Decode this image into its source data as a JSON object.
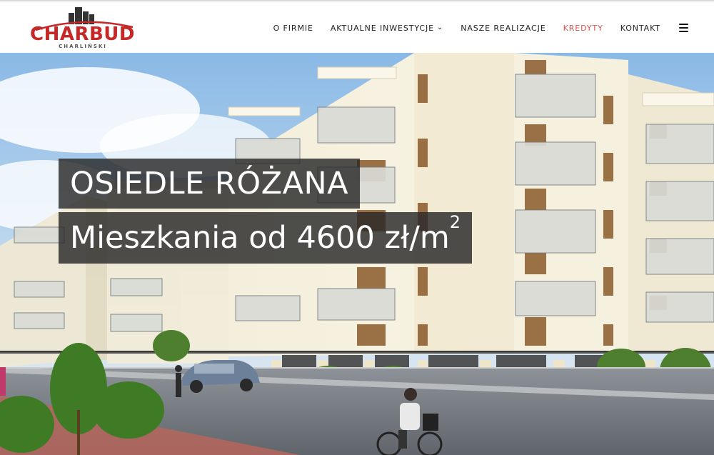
{
  "brand": {
    "name": "CHARBUD",
    "subtitle": "CHARLIŃSKI",
    "red": "#c62828",
    "dark": "#333333"
  },
  "nav": {
    "items": [
      {
        "label": "O FIRMIE",
        "active": false
      },
      {
        "label": "AKTUALNE INWESTYCJE",
        "active": false,
        "has_dropdown": true
      },
      {
        "label": "NASZE REALIZACJE",
        "active": false
      },
      {
        "label": "KREDYTY",
        "active": true
      },
      {
        "label": "KONTAKT",
        "active": false
      }
    ],
    "active_color": "#d9534f",
    "menu_icon": "hamburger-menu-icon",
    "dropdown_icon": "chevron-down-icon"
  },
  "hero": {
    "title": "OSIEDLE RÓŻANA",
    "subtitle_main": "Mieszkania od 4600 zł/m",
    "subtitle_sup": "2",
    "overlay_color": "rgba(40,40,40,0.82)"
  }
}
